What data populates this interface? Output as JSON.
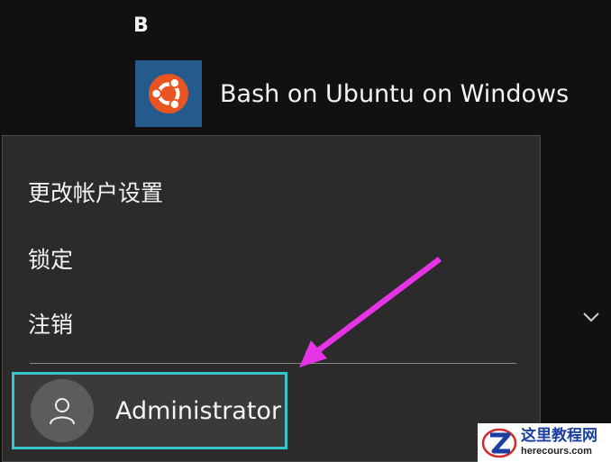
{
  "start_list": {
    "section_letter": "B",
    "app": {
      "label": "Bash on Ubuntu on Windows",
      "tile_color": "#245a8c",
      "icon": "ubuntu-logo-icon",
      "icon_color": "#e95420"
    }
  },
  "account_menu": {
    "items": [
      {
        "label": "更改帐户设置"
      },
      {
        "label": "锁定"
      },
      {
        "label": "注销"
      }
    ],
    "user": {
      "name": "Administrator",
      "avatar_icon": "person-icon"
    },
    "highlight_color": "#35c6d0"
  },
  "expand_icon": "chevron-down-icon",
  "annotation": {
    "type": "arrow",
    "color": "#e633e6"
  },
  "watermark": {
    "title": "这里教程网",
    "url": "herecours.com"
  }
}
